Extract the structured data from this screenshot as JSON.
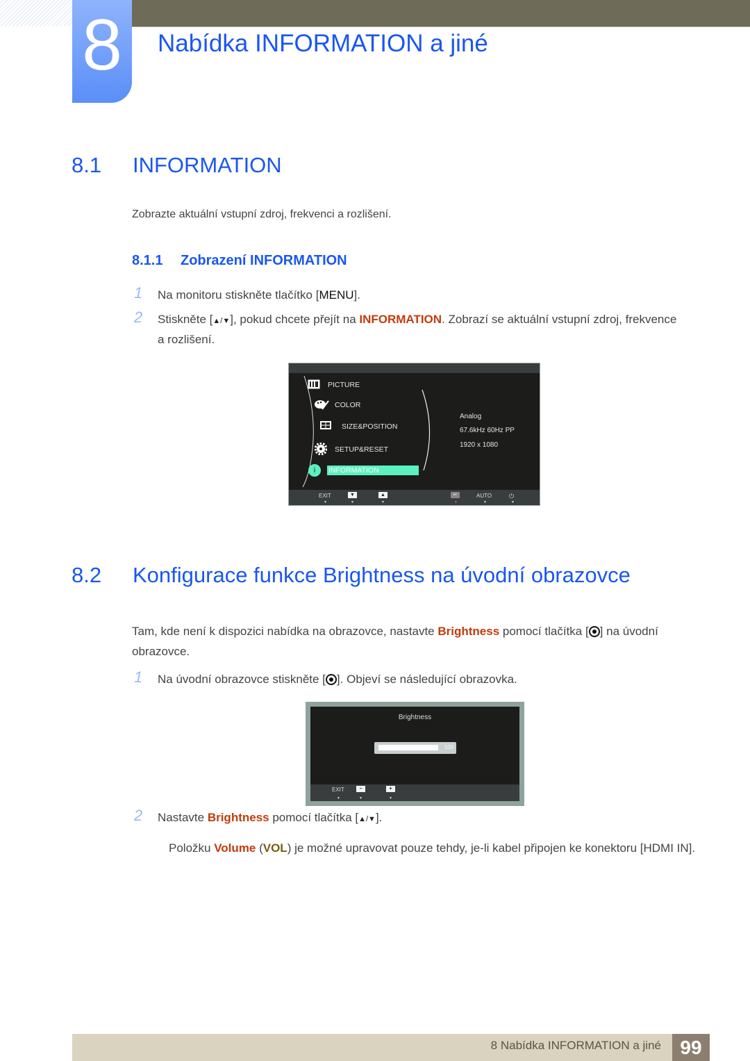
{
  "header": {
    "chapter_number": "8",
    "chapter_title": "Nabídka INFORMATION a jiné"
  },
  "section_8_1": {
    "number": "8.1",
    "title": "INFORMATION",
    "intro": "Zobrazte aktuální vstupní zdroj, frekvenci a rozlišení.",
    "subsection": {
      "number": "8.1.1",
      "title": "Zobrazení INFORMATION"
    },
    "steps": [
      {
        "num": "1",
        "pre": "Na monitoru stiskněte tlačítko [",
        "key": "MENU",
        "post": "]."
      },
      {
        "num": "2",
        "pre": "Stiskněte [",
        "key": "▲/▼",
        "mid": "], pokud chcete přejít na ",
        "highlight": "INFORMATION",
        "post": ". Zobrazí se aktuální vstupní zdroj, frekvence",
        "line2": "a rozlišení."
      }
    ]
  },
  "osd_menu": {
    "items": [
      {
        "label": "PICTURE",
        "icon": "picture-icon"
      },
      {
        "label": "COLOR",
        "icon": "palette-icon"
      },
      {
        "label": "SIZE&POSITION",
        "icon": "size-position-icon"
      },
      {
        "label": "SETUP&RESET",
        "icon": "gear-icon"
      },
      {
        "label": "INFORMATION",
        "icon": "info-icon",
        "selected": true
      }
    ],
    "info_values": [
      "Analog",
      "67.6kHz 60Hz PP",
      "1920 x 1080"
    ],
    "bottom_bar": {
      "exit": "EXIT",
      "down": "▼",
      "up": "▲",
      "enter": "↵",
      "auto": "AUTO",
      "power": "⏻"
    },
    "selected_color": "#5cf0c0"
  },
  "section_8_2": {
    "number": "8.2",
    "title": "Konfigurace funkce Brightness na úvodní obrazovce",
    "intro_pre": "Tam, kde není k dispozici nabídka na obrazovce, nastavte ",
    "intro_hl": "Brightness",
    "intro_mid": " pomocí tlačítka [",
    "intro_post": "] na úvodní",
    "intro_line2": "obrazovce.",
    "steps": [
      {
        "num": "1",
        "pre": "Na úvodní obrazovce stiskněte [",
        "post": "]. Objeví se následující obrazovka."
      },
      {
        "num": "2",
        "pre": "Nastavte ",
        "highlight": "Brightness",
        "mid": " pomocí tlačítka [",
        "key": "▲/▼",
        "post": "]."
      }
    ],
    "note_pre": "Položku ",
    "note_hl1": "Volume",
    "note_mid1": " (",
    "note_hl2": "VOL",
    "note_post": ") je možné upravovat pouze tehdy, je-li kabel připojen ke konektoru [HDMI IN]."
  },
  "brightness_osd": {
    "title": "Brightness",
    "value": "100",
    "fill_fraction": 1.0,
    "bottom_bar": {
      "exit": "EXIT",
      "minus": "−",
      "plus": "+"
    }
  },
  "footer": {
    "text": "8 Nabídka INFORMATION a jiné",
    "page": "99"
  },
  "colors": {
    "heading_blue": "#1a56f0",
    "highlight_orange": "#c23b0c",
    "topbar": "#6e6b58",
    "footer_bg": "#d9d3c0",
    "page_box": "#8c7f70"
  }
}
